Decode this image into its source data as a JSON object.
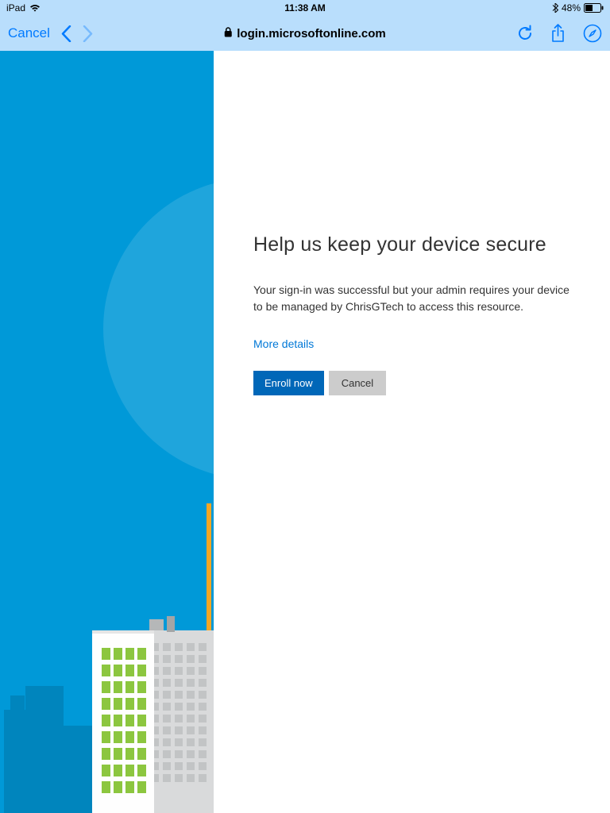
{
  "status_bar": {
    "device": "iPad",
    "time": "11:38 AM",
    "battery_pct": "48%"
  },
  "toolbar": {
    "cancel_label": "Cancel",
    "url": "login.microsoftonline.com"
  },
  "page": {
    "title": "Help us keep your device secure",
    "description": "Your sign-in was successful but your admin requires your device to be managed by ChrisGTech to access this resource.",
    "more_details_label": "More details",
    "enroll_label": "Enroll now",
    "cancel_label": "Cancel"
  }
}
